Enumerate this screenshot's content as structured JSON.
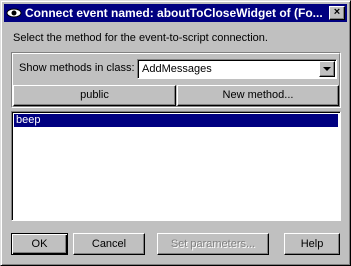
{
  "window": {
    "title": "Connect event named: aboutToCloseWidget of (Fo..."
  },
  "instructions": "Select the method for the event-to-script connection.",
  "class_selector": {
    "label": "Show methods in class:",
    "selected": "AddMessages"
  },
  "buttons": {
    "public": "public",
    "new_method": "New method...",
    "ok": "OK",
    "cancel": "Cancel",
    "set_parameters": "Set parameters...",
    "help": "Help"
  },
  "methods": [
    "beep"
  ],
  "selected_method": "beep"
}
